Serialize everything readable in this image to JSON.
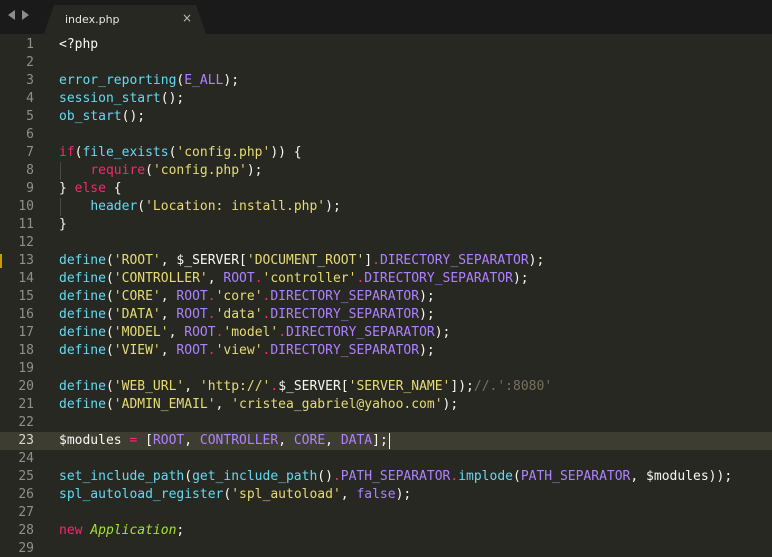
{
  "tabbar": {
    "nav_left_icon": "arrow-left-icon",
    "nav_right_icon": "arrow-right-icon",
    "tab": {
      "label": "index.php",
      "close_label": "×"
    }
  },
  "editor": {
    "theme": {
      "background": "#272822",
      "current_line": "#3e3d32"
    },
    "current_line": 23,
    "modified_marker_line": 13,
    "lines": [
      {
        "n": "1",
        "tokens": [
          {
            "t": "<?php",
            "c": "plain"
          }
        ]
      },
      {
        "n": "2",
        "tokens": []
      },
      {
        "n": "3",
        "tokens": [
          {
            "t": "error_reporting",
            "c": "fn"
          },
          {
            "t": "(",
            "c": "plain"
          },
          {
            "t": "E_ALL",
            "c": "const"
          },
          {
            "t": ");",
            "c": "plain"
          }
        ]
      },
      {
        "n": "4",
        "tokens": [
          {
            "t": "session_start",
            "c": "fn"
          },
          {
            "t": "();",
            "c": "plain"
          }
        ]
      },
      {
        "n": "5",
        "tokens": [
          {
            "t": "ob_start",
            "c": "fn"
          },
          {
            "t": "();",
            "c": "plain"
          }
        ]
      },
      {
        "n": "6",
        "tokens": []
      },
      {
        "n": "7",
        "tokens": [
          {
            "t": "if",
            "c": "kw"
          },
          {
            "t": "(",
            "c": "plain"
          },
          {
            "t": "file_exists",
            "c": "fn"
          },
          {
            "t": "(",
            "c": "plain"
          },
          {
            "t": "'config.php'",
            "c": "str"
          },
          {
            "t": ")) {",
            "c": "plain"
          }
        ]
      },
      {
        "n": "8",
        "tokens": [
          {
            "t": "    ",
            "c": "plain"
          },
          {
            "t": "require",
            "c": "kw"
          },
          {
            "t": "(",
            "c": "plain"
          },
          {
            "t": "'config.php'",
            "c": "str"
          },
          {
            "t": ");",
            "c": "plain"
          }
        ]
      },
      {
        "n": "9",
        "tokens": [
          {
            "t": "} ",
            "c": "plain"
          },
          {
            "t": "else",
            "c": "kw"
          },
          {
            "t": " {",
            "c": "plain"
          }
        ]
      },
      {
        "n": "10",
        "tokens": [
          {
            "t": "    ",
            "c": "plain"
          },
          {
            "t": "header",
            "c": "fn"
          },
          {
            "t": "(",
            "c": "plain"
          },
          {
            "t": "'Location: install.php'",
            "c": "str"
          },
          {
            "t": ");",
            "c": "plain"
          }
        ]
      },
      {
        "n": "11",
        "tokens": [
          {
            "t": "}",
            "c": "plain"
          }
        ]
      },
      {
        "n": "12",
        "tokens": []
      },
      {
        "n": "13",
        "tokens": [
          {
            "t": "define",
            "c": "fn"
          },
          {
            "t": "(",
            "c": "plain"
          },
          {
            "t": "'ROOT'",
            "c": "str"
          },
          {
            "t": ", ",
            "c": "plain"
          },
          {
            "t": "$_SERVER",
            "c": "var"
          },
          {
            "t": "[",
            "c": "plain"
          },
          {
            "t": "'DOCUMENT_ROOT'",
            "c": "str"
          },
          {
            "t": "]",
            "c": "plain"
          },
          {
            "t": ".",
            "c": "kw"
          },
          {
            "t": "DIRECTORY_SEPARATOR",
            "c": "const"
          },
          {
            "t": ");",
            "c": "plain"
          }
        ]
      },
      {
        "n": "14",
        "tokens": [
          {
            "t": "define",
            "c": "fn"
          },
          {
            "t": "(",
            "c": "plain"
          },
          {
            "t": "'CONTROLLER'",
            "c": "str"
          },
          {
            "t": ", ",
            "c": "plain"
          },
          {
            "t": "ROOT",
            "c": "const"
          },
          {
            "t": ".",
            "c": "kw"
          },
          {
            "t": "'controller'",
            "c": "str"
          },
          {
            "t": ".",
            "c": "kw"
          },
          {
            "t": "DIRECTORY_SEPARATOR",
            "c": "const"
          },
          {
            "t": ");",
            "c": "plain"
          }
        ]
      },
      {
        "n": "15",
        "tokens": [
          {
            "t": "define",
            "c": "fn"
          },
          {
            "t": "(",
            "c": "plain"
          },
          {
            "t": "'CORE'",
            "c": "str"
          },
          {
            "t": ", ",
            "c": "plain"
          },
          {
            "t": "ROOT",
            "c": "const"
          },
          {
            "t": ".",
            "c": "kw"
          },
          {
            "t": "'core'",
            "c": "str"
          },
          {
            "t": ".",
            "c": "kw"
          },
          {
            "t": "DIRECTORY_SEPARATOR",
            "c": "const"
          },
          {
            "t": ");",
            "c": "plain"
          }
        ]
      },
      {
        "n": "16",
        "tokens": [
          {
            "t": "define",
            "c": "fn"
          },
          {
            "t": "(",
            "c": "plain"
          },
          {
            "t": "'DATA'",
            "c": "str"
          },
          {
            "t": ", ",
            "c": "plain"
          },
          {
            "t": "ROOT",
            "c": "const"
          },
          {
            "t": ".",
            "c": "kw"
          },
          {
            "t": "'data'",
            "c": "str"
          },
          {
            "t": ".",
            "c": "kw"
          },
          {
            "t": "DIRECTORY_SEPARATOR",
            "c": "const"
          },
          {
            "t": ");",
            "c": "plain"
          }
        ]
      },
      {
        "n": "17",
        "tokens": [
          {
            "t": "define",
            "c": "fn"
          },
          {
            "t": "(",
            "c": "plain"
          },
          {
            "t": "'MODEL'",
            "c": "str"
          },
          {
            "t": ", ",
            "c": "plain"
          },
          {
            "t": "ROOT",
            "c": "const"
          },
          {
            "t": ".",
            "c": "kw"
          },
          {
            "t": "'model'",
            "c": "str"
          },
          {
            "t": ".",
            "c": "kw"
          },
          {
            "t": "DIRECTORY_SEPARATOR",
            "c": "const"
          },
          {
            "t": ");",
            "c": "plain"
          }
        ]
      },
      {
        "n": "18",
        "tokens": [
          {
            "t": "define",
            "c": "fn"
          },
          {
            "t": "(",
            "c": "plain"
          },
          {
            "t": "'VIEW'",
            "c": "str"
          },
          {
            "t": ", ",
            "c": "plain"
          },
          {
            "t": "ROOT",
            "c": "const"
          },
          {
            "t": ".",
            "c": "kw"
          },
          {
            "t": "'view'",
            "c": "str"
          },
          {
            "t": ".",
            "c": "kw"
          },
          {
            "t": "DIRECTORY_SEPARATOR",
            "c": "const"
          },
          {
            "t": ");",
            "c": "plain"
          }
        ]
      },
      {
        "n": "19",
        "tokens": []
      },
      {
        "n": "20",
        "tokens": [
          {
            "t": "define",
            "c": "fn"
          },
          {
            "t": "(",
            "c": "plain"
          },
          {
            "t": "'WEB_URL'",
            "c": "str"
          },
          {
            "t": ", ",
            "c": "plain"
          },
          {
            "t": "'http://'",
            "c": "str"
          },
          {
            "t": ".",
            "c": "kw"
          },
          {
            "t": "$_SERVER",
            "c": "var"
          },
          {
            "t": "[",
            "c": "plain"
          },
          {
            "t": "'SERVER_NAME'",
            "c": "str"
          },
          {
            "t": "]);",
            "c": "plain"
          },
          {
            "t": "//.':8080'",
            "c": "cmt"
          }
        ]
      },
      {
        "n": "21",
        "tokens": [
          {
            "t": "define",
            "c": "fn"
          },
          {
            "t": "(",
            "c": "plain"
          },
          {
            "t": "'ADMIN_EMAIL'",
            "c": "str"
          },
          {
            "t": ", ",
            "c": "plain"
          },
          {
            "t": "'cristea_gabriel@yahoo.com'",
            "c": "str"
          },
          {
            "t": ");",
            "c": "plain"
          }
        ]
      },
      {
        "n": "22",
        "tokens": []
      },
      {
        "n": "23",
        "tokens": [
          {
            "t": "$modules",
            "c": "var"
          },
          {
            "t": " ",
            "c": "plain"
          },
          {
            "t": "=",
            "c": "kw"
          },
          {
            "t": " [",
            "c": "plain"
          },
          {
            "t": "ROOT",
            "c": "const"
          },
          {
            "t": ", ",
            "c": "plain"
          },
          {
            "t": "CONTROLLER",
            "c": "const"
          },
          {
            "t": ", ",
            "c": "plain"
          },
          {
            "t": "CORE",
            "c": "const"
          },
          {
            "t": ", ",
            "c": "plain"
          },
          {
            "t": "DATA",
            "c": "const"
          },
          {
            "t": "];",
            "c": "plain"
          }
        ]
      },
      {
        "n": "24",
        "tokens": []
      },
      {
        "n": "25",
        "tokens": [
          {
            "t": "set_include_path",
            "c": "fn"
          },
          {
            "t": "(",
            "c": "plain"
          },
          {
            "t": "get_include_path",
            "c": "fn"
          },
          {
            "t": "()",
            "c": "plain"
          },
          {
            "t": ".",
            "c": "kw"
          },
          {
            "t": "PATH_SEPARATOR",
            "c": "const"
          },
          {
            "t": ".",
            "c": "kw"
          },
          {
            "t": "implode",
            "c": "fn"
          },
          {
            "t": "(",
            "c": "plain"
          },
          {
            "t": "PATH_SEPARATOR",
            "c": "const"
          },
          {
            "t": ", ",
            "c": "plain"
          },
          {
            "t": "$modules",
            "c": "var"
          },
          {
            "t": "));",
            "c": "plain"
          }
        ]
      },
      {
        "n": "26",
        "tokens": [
          {
            "t": "spl_autoload_register",
            "c": "fn"
          },
          {
            "t": "(",
            "c": "plain"
          },
          {
            "t": "'spl_autoload'",
            "c": "str"
          },
          {
            "t": ", ",
            "c": "plain"
          },
          {
            "t": "false",
            "c": "const"
          },
          {
            "t": ");",
            "c": "plain"
          }
        ]
      },
      {
        "n": "27",
        "tokens": []
      },
      {
        "n": "28",
        "tokens": [
          {
            "t": "new",
            "c": "kw"
          },
          {
            "t": " ",
            "c": "plain"
          },
          {
            "t": "Application",
            "c": "class"
          },
          {
            "t": ";",
            "c": "plain"
          }
        ]
      },
      {
        "n": "29",
        "tokens": []
      }
    ]
  }
}
